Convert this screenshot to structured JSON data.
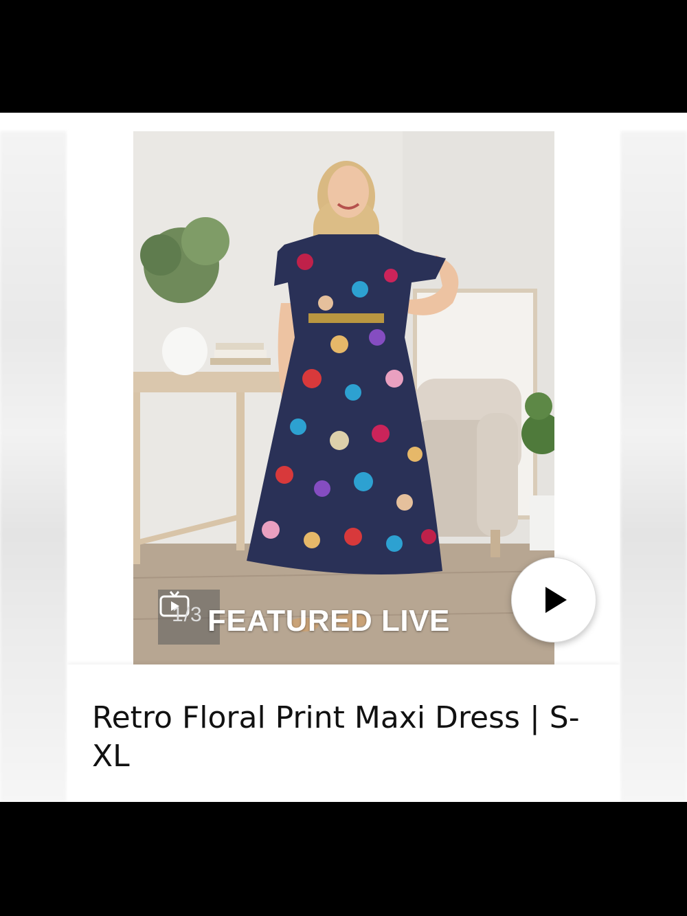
{
  "media": {
    "counter": "1/3",
    "badge_label": "FEATURED LIVE",
    "video_icon": "video-tv-icon",
    "play_icon": "play-icon"
  },
  "product": {
    "title": "Retro Floral Print Maxi Dress | S-XL"
  },
  "colors": {
    "background": "#000000",
    "card": "#ffffff",
    "title_text": "#111111",
    "badge_text": "#ffffff"
  }
}
